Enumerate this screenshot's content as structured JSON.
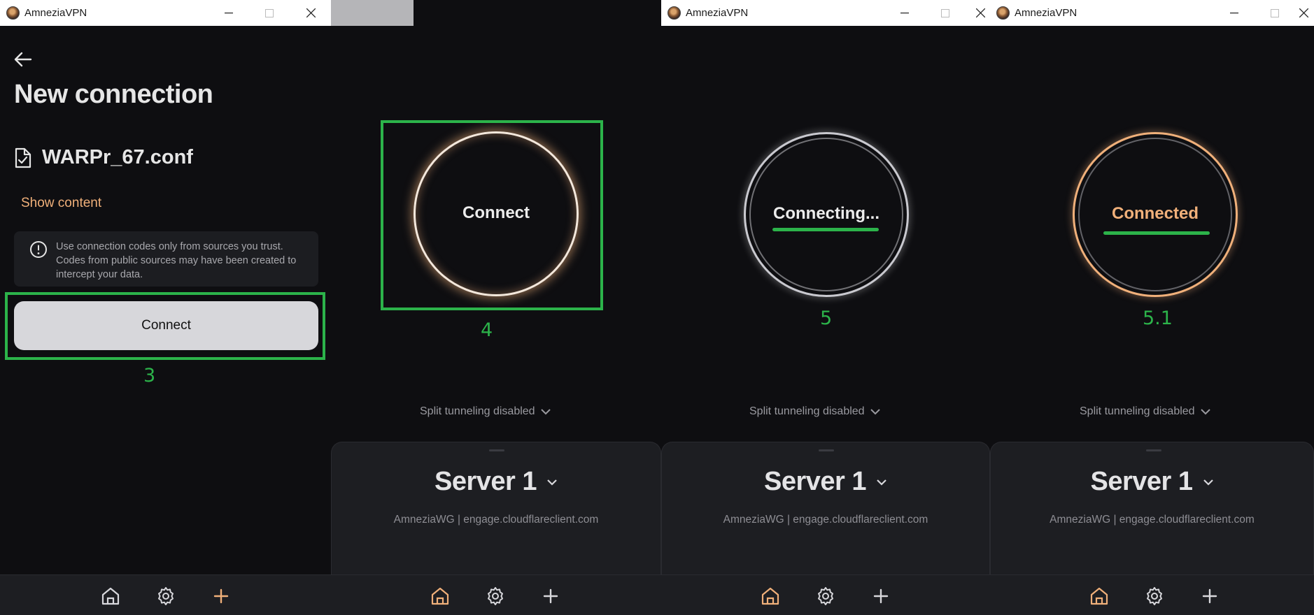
{
  "app": {
    "title": "AmneziaVPN"
  },
  "colors": {
    "accent": "#f0b07a",
    "annotation": "#2cb34a",
    "bg": "#0e0e11",
    "panel": "#1d1e22"
  },
  "icons": {
    "back": "arrow-left-icon",
    "file": "file-check-icon",
    "warning": "info-circle-icon",
    "home": "home-icon",
    "settings": "gear-icon",
    "add": "plus-icon",
    "chevron": "chevron-down-icon"
  },
  "screen1": {
    "page_title": "New connection",
    "file_name": "WARPr_67.conf",
    "show_content": "Show content",
    "warning": "Use connection codes only from sources you trust. Codes from public sources may have been created to intercept your data.",
    "connect_label": "Connect",
    "annotation": "3"
  },
  "screen2": {
    "ring_label": "Connect",
    "annotation": "4",
    "split": "Split tunneling disabled",
    "server_name": "Server 1",
    "server_sub": "AmneziaWG | engage.cloudflareclient.com"
  },
  "screen3": {
    "ring_label": "Connecting...",
    "annotation": "5",
    "split": "Split tunneling disabled",
    "server_name": "Server 1",
    "server_sub": "AmneziaWG | engage.cloudflareclient.com"
  },
  "screen4": {
    "ring_label": "Connected",
    "annotation": "5.1",
    "split": "Split tunneling disabled",
    "server_name": "Server 1",
    "server_sub": "AmneziaWG | engage.cloudflareclient.com"
  }
}
